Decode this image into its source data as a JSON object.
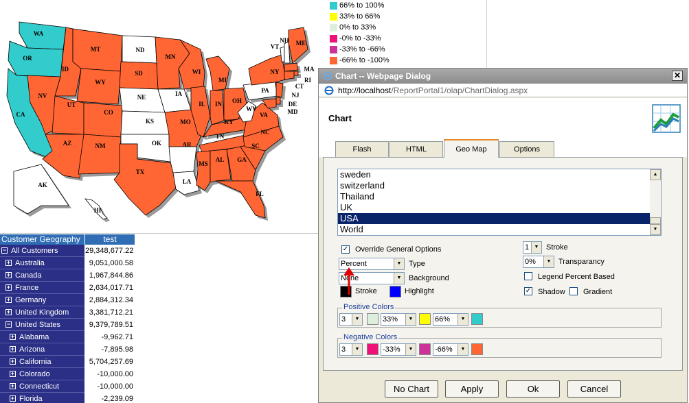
{
  "map": {
    "state_labels": [
      {
        "code": "WA",
        "color": "#33cccc"
      },
      {
        "code": "OR",
        "color": "#33cccc"
      },
      {
        "code": "CA",
        "color": "#33cccc"
      },
      {
        "code": "ID",
        "color": "#ff6633"
      },
      {
        "code": "NV",
        "color": "#ff6633"
      },
      {
        "code": "MT",
        "color": "#ff6633"
      },
      {
        "code": "WY",
        "color": "#ff6633"
      },
      {
        "code": "UT",
        "color": "#ff6633"
      },
      {
        "code": "AZ",
        "color": "#ff6633"
      },
      {
        "code": "CO",
        "color": "#ff6633"
      },
      {
        "code": "NM",
        "color": "#ff6633"
      },
      {
        "code": "ND",
        "color": "#ffffff"
      },
      {
        "code": "SD",
        "color": "#ff6633"
      },
      {
        "code": "NE",
        "color": "#ffffff"
      },
      {
        "code": "KS",
        "color": "#ffffff"
      },
      {
        "code": "OK",
        "color": "#ffffff"
      },
      {
        "code": "TX",
        "color": "#ff6633"
      },
      {
        "code": "MN",
        "color": "#ff6633"
      },
      {
        "code": "IA",
        "color": "#ffffff"
      },
      {
        "code": "MO",
        "color": "#ff6633"
      },
      {
        "code": "AR",
        "color": "#ffffff"
      },
      {
        "code": "LA",
        "color": "#ffffff"
      },
      {
        "code": "WI",
        "color": "#ff6633"
      },
      {
        "code": "IL",
        "color": "#ff6633"
      },
      {
        "code": "MI",
        "color": "#ff6633"
      },
      {
        "code": "IN",
        "color": "#ff6633"
      },
      {
        "code": "OH",
        "color": "#ff6633"
      },
      {
        "code": "KY",
        "color": "#ff6633"
      },
      {
        "code": "TN",
        "color": "#ff6633"
      },
      {
        "code": "MS",
        "color": "#ff6633"
      },
      {
        "code": "AL",
        "color": "#ff6633"
      },
      {
        "code": "GA",
        "color": "#ff6633"
      },
      {
        "code": "FL",
        "color": "#ff6633"
      },
      {
        "code": "SC",
        "color": "#ff6633"
      },
      {
        "code": "NC",
        "color": "#ff6633"
      },
      {
        "code": "VA",
        "color": "#ff6633"
      },
      {
        "code": "WV",
        "color": "#ffffff"
      },
      {
        "code": "PA",
        "color": "#ffffff"
      },
      {
        "code": "NY",
        "color": "#ff6633"
      },
      {
        "code": "VT",
        "color": "#ffffff"
      },
      {
        "code": "NH",
        "color": "#ffffff"
      },
      {
        "code": "ME",
        "color": "#ff6633"
      },
      {
        "code": "MA",
        "color": "#ff6633"
      },
      {
        "code": "RI",
        "color": "#ff6633"
      },
      {
        "code": "CT",
        "color": "#ff6633"
      },
      {
        "code": "NJ",
        "color": "#ff6633"
      },
      {
        "code": "DE",
        "color": "#ff6633"
      },
      {
        "code": "MD",
        "color": "#ff6633"
      },
      {
        "code": "AK",
        "color": "#ffffff"
      },
      {
        "code": "HI",
        "color": "#ffffff"
      }
    ]
  },
  "legend": {
    "items": [
      {
        "label": "66% to 100%",
        "color": "#33cccc"
      },
      {
        "label": "33% to 66%",
        "color": "#ffff00"
      },
      {
        "label": "0%   to 33%",
        "color": "#ddeedd"
      },
      {
        "label": "-0% to -33%",
        "color": "#ee1177"
      },
      {
        "label": "-33% to -66%",
        "color": "#cc3399"
      },
      {
        "label": "-66% to -100%",
        "color": "#ff6633"
      }
    ]
  },
  "pivot": {
    "col1": "Customer Geography",
    "col2": "test",
    "rows": [
      {
        "name": "All Customers",
        "value": "29,348,677.22",
        "indent": 0,
        "box": "−"
      },
      {
        "name": "Australia",
        "value": "9,051,000.58",
        "indent": 1,
        "box": "+"
      },
      {
        "name": "Canada",
        "value": "1,967,844.86",
        "indent": 1,
        "box": "+"
      },
      {
        "name": "France",
        "value": "2,634,017.71",
        "indent": 1,
        "box": "+"
      },
      {
        "name": "Germany",
        "value": "2,884,312.34",
        "indent": 1,
        "box": "+"
      },
      {
        "name": "United Kingdom",
        "value": "3,381,712.21",
        "indent": 1,
        "box": "+"
      },
      {
        "name": "United States",
        "value": "9,379,789.51",
        "indent": 1,
        "box": "−"
      },
      {
        "name": "Alabama",
        "value": "-9,962.71",
        "indent": 2,
        "box": "+"
      },
      {
        "name": "Arizona",
        "value": "-7,895.98",
        "indent": 2,
        "box": "+"
      },
      {
        "name": "California",
        "value": "5,704,257.69",
        "indent": 2,
        "box": "+"
      },
      {
        "name": "Colorado",
        "value": "-10,000.00",
        "indent": 2,
        "box": "+"
      },
      {
        "name": "Connecticut",
        "value": "-10,000.00",
        "indent": 2,
        "box": "+"
      },
      {
        "name": "Florida",
        "value": "-2,239.09",
        "indent": 2,
        "box": "+"
      }
    ]
  },
  "dialog": {
    "title": "Chart -- Webpage Dialog",
    "url_host": "http://localhost",
    "url_path": "/ReportPortal1/olap/ChartDialog.aspx",
    "heading": "Chart",
    "tabs": [
      "Flash",
      "HTML",
      "Geo Map",
      "Options"
    ],
    "active_tab": "Geo Map",
    "map_list": [
      "sweden",
      "switzerland",
      "Thailand",
      "UK",
      "USA",
      "World"
    ],
    "map_selected": "USA",
    "override_label": "Override General Options",
    "type_value": "Percent",
    "type_label": "Type",
    "background_value": "None",
    "background_label": "Background",
    "stroke_label": "Stroke",
    "highlight_label": "Highlight",
    "stroke_width_value": "1",
    "stroke_width_label": "Stroke",
    "transparency_value": "0%",
    "transparency_label": "Transparancy",
    "legend_percent_label": "Legend Percent Based",
    "shadow_label": "Shadow",
    "gradient_label": "Gradient",
    "positive_title": "Positive Colors",
    "positive_count": "3",
    "positive_mid1": "33%",
    "positive_mid2": "66%",
    "negative_title": "Negative Colors",
    "negative_count": "3",
    "negative_mid1": "-33%",
    "negative_mid2": "-66%",
    "buttons": {
      "nochart": "No Chart",
      "apply": "Apply",
      "ok": "Ok",
      "cancel": "Cancel"
    },
    "colors": {
      "stroke": "#000000",
      "highlight": "#0000ff",
      "pos1": "#ddeedd",
      "pos2": "#ffff00",
      "pos3": "#33cccc",
      "neg1": "#ee1177",
      "neg2": "#cc3399",
      "neg3": "#ff6633"
    },
    "checks": {
      "override": true,
      "legend_percent": false,
      "shadow": true,
      "gradient": false
    }
  }
}
